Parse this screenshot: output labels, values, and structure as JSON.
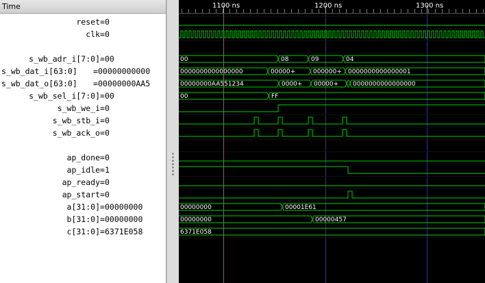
{
  "header": {
    "time_label": "Time"
  },
  "timeline": {
    "ticks": [
      "1100 ns",
      "1200 ns",
      "1300 ns"
    ]
  },
  "signals": [
    {
      "name": "reset",
      "value": "0"
    },
    {
      "name": "clk",
      "value": "0"
    },
    {
      "name": "",
      "value": ""
    },
    {
      "name": "s_wb_adr_i[7:0]",
      "value": "00"
    },
    {
      "name": "s_wb_dat_i[63:0]",
      "value": "00000000000"
    },
    {
      "name": "s_wb_dat_o[63:0]",
      "value": "00000000AA5"
    },
    {
      "name": "s_wb_sel_i[7:0]",
      "value": "00"
    },
    {
      "name": "s_wb_we_i",
      "value": "0"
    },
    {
      "name": "s_wb_stb_i",
      "value": "0"
    },
    {
      "name": "s_wb_ack_o",
      "value": "0"
    },
    {
      "name": "",
      "value": ""
    },
    {
      "name": "ap_done",
      "value": "0"
    },
    {
      "name": "ap_idle",
      "value": "1"
    },
    {
      "name": "ap_ready",
      "value": "0"
    },
    {
      "name": "ap_start",
      "value": "0"
    },
    {
      "name": "a[31:0]",
      "value": "00000000"
    },
    {
      "name": "b[31:0]",
      "value": "00000000"
    },
    {
      "name": "c[31:0]",
      "value": "6371E058"
    }
  ],
  "bus_labels": {
    "adr": [
      "00",
      "08",
      "09",
      "04"
    ],
    "dat_i": [
      "0000000000000000",
      "00000+",
      "000000+",
      "0000000000000001"
    ],
    "dat_o": [
      "00000000AA551234",
      "0000+",
      "00000+",
      "0000000000000000"
    ],
    "sel": [
      "00",
      "FF"
    ],
    "a": [
      "00000000",
      "00001E61"
    ],
    "b": [
      "00000000",
      "00000457"
    ],
    "c": [
      "6371E058"
    ]
  },
  "colors": {
    "wave": "#00d000",
    "cursor": "#e04040",
    "grid": "#2a2ad0",
    "background": "#000000",
    "bus_text": "#ffffff"
  }
}
